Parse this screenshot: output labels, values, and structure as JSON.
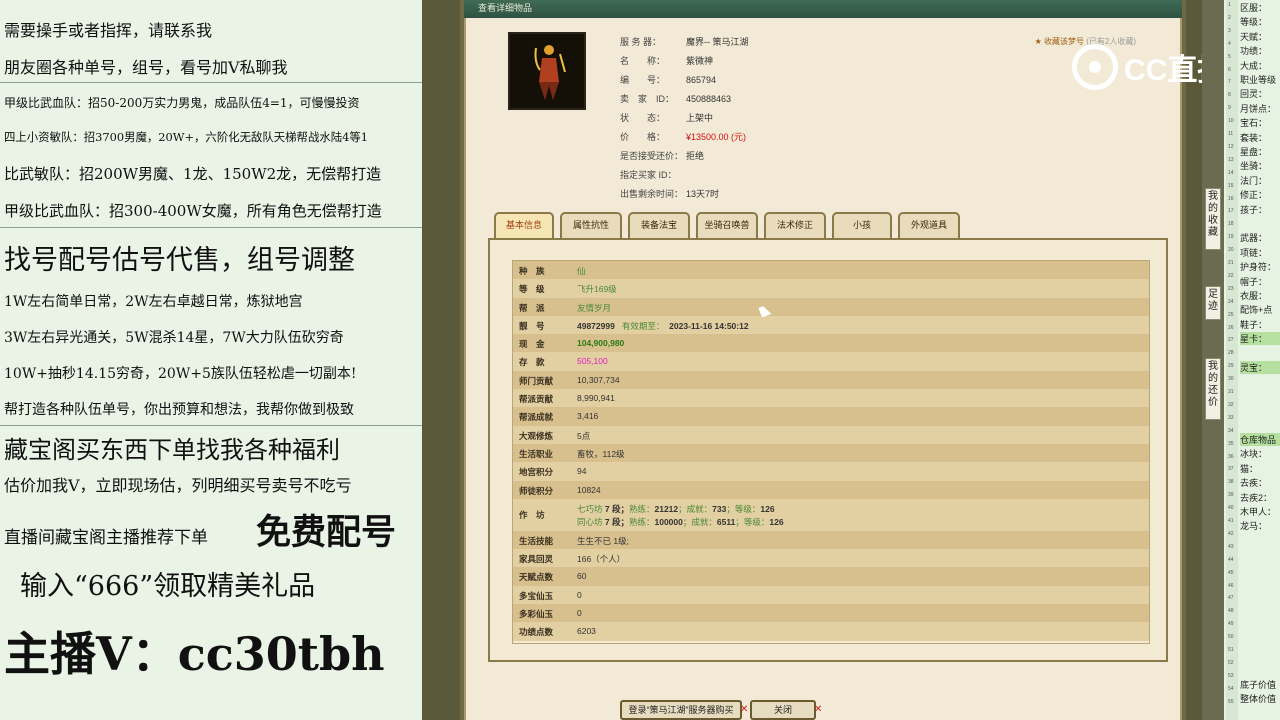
{
  "left_overlay": {
    "lines": [
      "需要操手或者指挥，请联系我",
      "朋友圈各种单号，组号，看号加V私聊我",
      "甲级比武血队：招50-200万实力男鬼，成品队伍4=1，可慢慢投资",
      "四上小资敏队：招3700男魔，20W+，六阶化无敌队天梯帮战水陆4等1",
      "比武敏队：招200W男魔、1龙、150W2龙，无偿帮打造",
      "甲级比武血队：招300-400W女魔，所有角色无偿帮打造",
      "找号配号估号代售，组号调整",
      "1W左右简单日常，2W左右卓越日常，炼狱地宫",
      "3W左右异光通关，5W混杀14星，7W大力队伍砍穷奇",
      "10W+抽秒14.15穷奇，20W+5族队伍轻松虐一切副本!",
      "帮打造各种队伍单号，你出预算和想法，我帮你做到极致",
      "藏宝阁买东西下单找我各种福利",
      "估价加我V，立即现场估，列明细买号卖号不吃亏",
      "直播间藏宝阁主播推荐下单",
      "免费配号",
      "输入“666”领取精美礼品",
      "主播V：cc30tbh"
    ]
  },
  "window": {
    "title": "查看详细物品",
    "info": [
      {
        "k": "服 务 器：",
        "v": "魔界-- 策马江湖"
      },
      {
        "k": "名　　称：",
        "v": "紫微神"
      },
      {
        "k": "编　　号：",
        "v": "865794"
      },
      {
        "k": "卖　家　ID：",
        "v": "450888463"
      },
      {
        "k": "状　　态：",
        "v": "上架中"
      },
      {
        "k": "价　　格：",
        "v": "¥13500.00 (元)"
      },
      {
        "k": "是否接受还价：",
        "v": "拒绝"
      },
      {
        "k": "指定买家 ID：",
        "v": ""
      },
      {
        "k": "出售剩余时间：",
        "v": "13天7时"
      }
    ],
    "favorite": "收藏该梦号",
    "favorite_count": "(已有2人收藏)",
    "tabs": [
      "基本信息",
      "属性抗性",
      "装备法宝",
      "坐骑召唤兽",
      "法术修正",
      "小孩",
      "外观道具"
    ],
    "attributes": [
      {
        "k": "种　族",
        "v": "仙"
      },
      {
        "k": "等　级",
        "v": "飞升169级"
      },
      {
        "k": "帮　派",
        "v": "友情岁月"
      },
      {
        "k": "靓　号",
        "v": "49872999",
        "v_label": "有效期至：",
        "v_date": "2023-11-16 14:50:12"
      },
      {
        "k": "现　金",
        "v": "104,900,980"
      },
      {
        "k": "存　款",
        "v": "505,100"
      },
      {
        "k": "师门贡献",
        "v": "10,307,734"
      },
      {
        "k": "帮派贡献",
        "v": "8,990,941"
      },
      {
        "k": "帮派成就",
        "v": "3,416"
      },
      {
        "k": "大观修炼",
        "v": "5点"
      },
      {
        "k": "生活职业",
        "v": "畜牧，112级"
      },
      {
        "k": "地宫积分",
        "v": "94"
      },
      {
        "k": "师徒积分",
        "v": "10824"
      },
      {
        "k": "作　坊",
        "line1": {
          "name": "七巧坊",
          "lvl_label": "7 段；",
          "exp_label": "熟练：",
          "exp": "21212",
          "ach_label": "；成就：",
          "ach": "733",
          "grade_label": "；等级：",
          "grade": "126"
        },
        "line2": {
          "name": "同心坊",
          "lvl_label": "7 段；",
          "exp_label": "熟练：",
          "exp": "100000",
          "ach_label": "；成就：",
          "ach": "6511",
          "grade_label": "；等级：",
          "grade": "126"
        }
      },
      {
        "k": "生活技能",
        "v": "生生不已 1级;"
      },
      {
        "k": "家具回灵",
        "v": "166（个人）"
      },
      {
        "k": "天赋点数",
        "v": "60"
      },
      {
        "k": "多宝仙玉",
        "v": "0"
      },
      {
        "k": "多彩仙玉",
        "v": "0"
      },
      {
        "k": "功绩点数",
        "v": "6203"
      }
    ],
    "buttons": {
      "login": "登录“策马江湖”服务器购买",
      "close": "关闭"
    }
  },
  "logo": {
    "text": "CC直播"
  },
  "sidebar": {
    "buttons": [
      "我的收藏",
      "足迹",
      "我的还价"
    ],
    "labels": [
      "区服：",
      "等级：",
      "天赋：",
      "功绩：",
      "大成：",
      "职业等级",
      "回灵：",
      "月饼点：",
      "宝石：",
      "套装：",
      "星盘：",
      "坐骑：",
      "法门：",
      "修正：",
      "孩子：",
      "",
      "武器：",
      "项链：",
      "护身符：",
      "帽子：",
      "衣服：",
      "配饰+点",
      "鞋子：",
      "星卡：",
      "",
      "灵宝：",
      "",
      "",
      "",
      "",
      "仓库物品",
      "冰块：",
      "猫：",
      "去疾：",
      "去疾2：",
      "木甲人：",
      "龙马：",
      "",
      "",
      "",
      "",
      "",
      "",
      "",
      "",
      "",
      "",
      "底子价值",
      "整体价值"
    ],
    "numbers": [
      "1",
      "2",
      "3",
      "4",
      "5",
      "6",
      "7",
      "8",
      "9",
      "10",
      "11",
      "12",
      "13",
      "14",
      "15",
      "16",
      "17",
      "18",
      "19",
      "20",
      "21",
      "22",
      "23",
      "24",
      "25",
      "26",
      "27",
      "28",
      "29",
      "30",
      "31",
      "32",
      "33",
      "34",
      "35",
      "36",
      "37",
      "38",
      "39",
      "40",
      "41",
      "42",
      "43",
      "44",
      "45",
      "46",
      "47",
      "48",
      "49",
      "50",
      "51",
      "52",
      "53",
      "54",
      "55"
    ]
  },
  "colors": {
    "price": "#d01010",
    "accent_green": "#4a8a3a",
    "deposit": "#e020c0",
    "frame": "#a89a6a"
  }
}
